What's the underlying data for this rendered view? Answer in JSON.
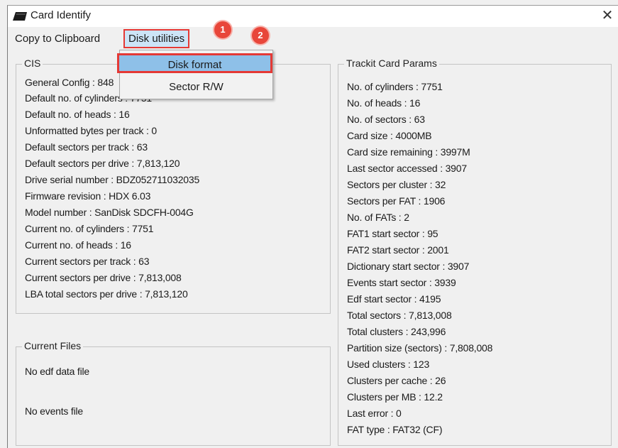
{
  "window": {
    "title": "Card Identify",
    "close_glyph": "✕"
  },
  "menu": {
    "copy": "Copy to Clipboard",
    "disk": "Disk utilities"
  },
  "dropdown": {
    "items": [
      "Disk format",
      "Sector R/W"
    ]
  },
  "badges": [
    "1",
    "2"
  ],
  "cis": {
    "label": "CIS",
    "lines": [
      "General Config : 848",
      "Default no. of cylinders :  7751",
      "Default no. of heads :  16",
      "Unformatted bytes per track :  0",
      "Default sectors per track :  63",
      "Default sectors per drive : 7,813,120",
      "Drive serial number : BDZ052711032035",
      "Firmware revision : HDX 6.03",
      "Model number : SanDisk SDCFH-004G",
      "Current no. of cylinders :  7751",
      "Current no. of heads :  16",
      "Current sectors per track :  63",
      "Current sectors per drive : 7,813,008",
      "LBA total sectors per drive : 7,813,120"
    ]
  },
  "files": {
    "label": "Current Files",
    "edf": "No edf data file",
    "events": "No events file"
  },
  "trackit": {
    "label": "Trackit Card Params",
    "lines": [
      "No. of cylinders :  7751",
      "No. of heads :  16",
      "No. of sectors :  63",
      "Card size :  4000MB",
      "Card size remaining : 3997M",
      "Last sector accessed : 3907",
      "Sectors per cluster :  32",
      "Sectors per FAT :  1906",
      "No. of FATs :  2",
      "FAT1 start sector : 95",
      "FAT2 start sector : 2001",
      "Dictionary start sector : 3907",
      "Events start sector : 3939",
      "Edf start sector :  4195",
      "Total sectors : 7,813,008",
      "Total clusters : 243,996",
      "Partition size (sectors) : 7,808,008",
      "Used clusters :  123",
      "Clusters per cache :  26",
      "Clusters per MB :  12.2",
      "Last error :  0",
      "FAT type : FAT32 (CF)"
    ]
  }
}
